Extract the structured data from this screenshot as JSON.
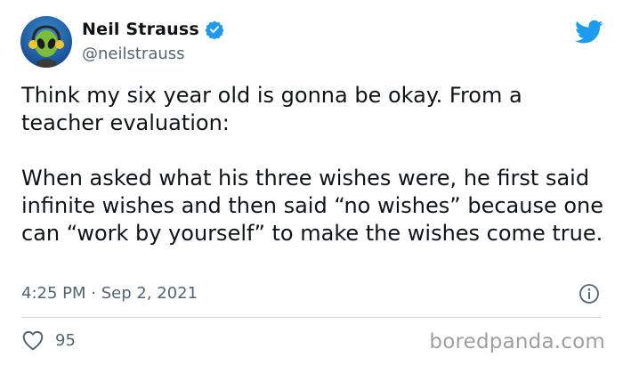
{
  "author": {
    "name": "Neil Strauss",
    "handle": "@neilstrauss",
    "verified": true,
    "avatar_icon": "alien-headphones-avatar"
  },
  "tweet": {
    "paragraphs": [
      "Think my six year old is gonna be okay. From a teacher evaluation:",
      "When asked what his three wishes were, he first said infinite wishes and then said “no wishes” because one can “work by yourself” to make the wishes come true."
    ],
    "time": "4:25 PM",
    "separator": "·",
    "date": "Sep 2, 2021"
  },
  "engagement": {
    "likes": "95"
  },
  "watermark": "boredpanda.com",
  "colors": {
    "twitter_blue": "#1d9bf0",
    "secondary_text": "#536471",
    "divider": "#cfd9de"
  }
}
